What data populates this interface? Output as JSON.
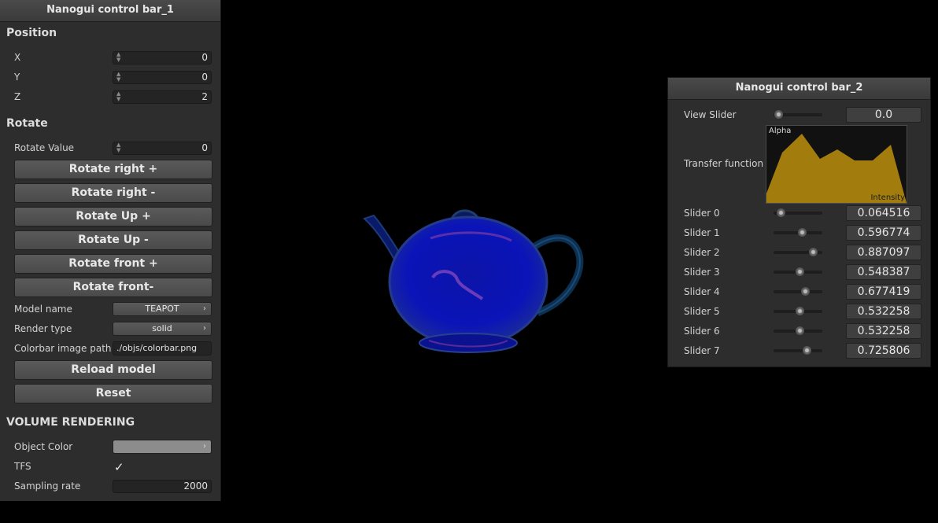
{
  "panel1": {
    "title": "Nanogui control bar_1",
    "position": {
      "heading": "Position",
      "x_label": "X",
      "x_value": "0",
      "y_label": "Y",
      "y_value": "0",
      "z_label": "Z",
      "z_value": "2"
    },
    "rotate": {
      "heading": "Rotate",
      "value_label": "Rotate Value",
      "value": "0",
      "buttons": [
        "Rotate right +",
        "Rotate right -",
        "Rotate Up +",
        "Rotate Up -",
        "Rotate front +",
        "Rotate front-"
      ]
    },
    "model_name_label": "Model name",
    "model_name": "TEAPOT",
    "render_type_label": "Render type",
    "render_type": "solid",
    "colorbar_label": "Colorbar image path",
    "colorbar_path": "./objs/colorbar.png",
    "reload_label": "Reload model",
    "reset_label": "Reset",
    "volume": {
      "heading": "VOLUME RENDERING",
      "object_color_label": "Object Color",
      "object_color": "#8c8c8c",
      "tfs_label": "TFS",
      "tfs_checked": true,
      "sampling_label": "Sampling rate",
      "sampling_value": "2000"
    }
  },
  "panel2": {
    "title": "Nanogui control bar_2",
    "view_slider_label": "View Slider",
    "view_slider_value": "0.0",
    "view_slider_pos": 0.0,
    "transfer_label": "Transfer function",
    "transfer_alpha": "Alpha",
    "transfer_intensity": "Intensity",
    "transfer_color": "#a27d0e",
    "sliders": [
      {
        "label": "Slider 0",
        "value": "0.064516",
        "pos": 0.064516
      },
      {
        "label": "Slider 1",
        "value": "0.596774",
        "pos": 0.596774
      },
      {
        "label": "Slider 2",
        "value": "0.887097",
        "pos": 0.887097
      },
      {
        "label": "Slider 3",
        "value": "0.548387",
        "pos": 0.548387
      },
      {
        "label": "Slider 4",
        "value": "0.677419",
        "pos": 0.677419
      },
      {
        "label": "Slider 5",
        "value": "0.532258",
        "pos": 0.532258
      },
      {
        "label": "Slider 6",
        "value": "0.532258",
        "pos": 0.532258
      },
      {
        "label": "Slider 7",
        "value": "0.725806",
        "pos": 0.725806
      }
    ]
  }
}
